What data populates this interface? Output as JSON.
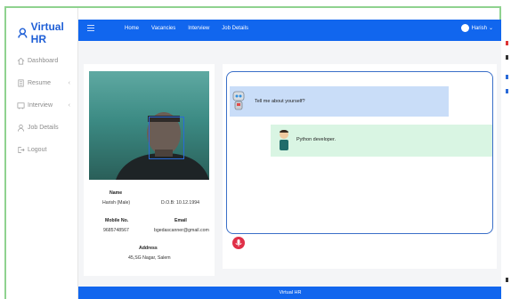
{
  "brand": {
    "name": "Virtual HR"
  },
  "sidebar": {
    "items": [
      {
        "label": "Dashboard",
        "icon": "home-icon",
        "chevron": false
      },
      {
        "label": "Resume",
        "icon": "resume-icon",
        "chevron": true
      },
      {
        "label": "Interview",
        "icon": "interview-icon",
        "chevron": true
      },
      {
        "label": "Job Details",
        "icon": "user-icon",
        "chevron": false
      },
      {
        "label": "Logout",
        "icon": "logout-icon",
        "chevron": false
      }
    ]
  },
  "topbar": {
    "menu": [
      "Home",
      "Vacancies",
      "Interview",
      "Job Details"
    ],
    "user": "Harish"
  },
  "profile": {
    "name_label": "Name",
    "name_value": "Harish (Male)",
    "dob": "D.O.B: 10.12.1994",
    "mobile_label": "Mobile No.",
    "mobile_value": "9685748567",
    "email_label": "Email",
    "email_value": "bgedascanner@gmail.com",
    "address_label": "Address",
    "address_value": "45,SG Nagar, Salem"
  },
  "chat": {
    "question": "Tell me about yourself?",
    "answer": "Python developer."
  },
  "footer": {
    "text": "Virtual HR"
  },
  "colors": {
    "primary": "#1166ee",
    "question_bg": "#c9ddf8",
    "answer_bg": "#d9f5e3",
    "mic": "#e03048"
  }
}
